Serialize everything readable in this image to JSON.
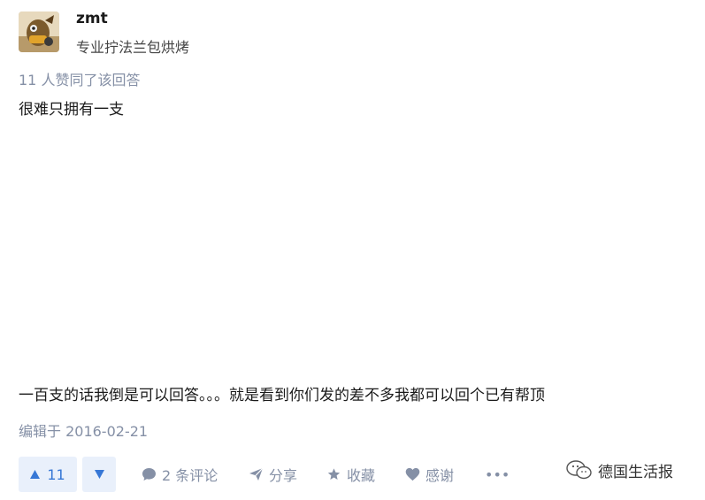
{
  "author": {
    "name": "zmt",
    "bio": "专业拧法兰包烘烤",
    "avatar_icon": "cartoon-avatar"
  },
  "answer": {
    "upvote_info": "11 人赞同了该回答",
    "lines": [
      "很难只拥有一支",
      "一百支的话我倒是可以回答。。。就是看到你们发的差不多我都可以回个已有帮顶"
    ],
    "edit_time": "编辑于 2016-02-21"
  },
  "actions": {
    "upvote_count": "11",
    "comments_label": "2 条评论",
    "share_label": "分享",
    "favorite_label": "收藏",
    "thanks_label": "感谢",
    "more_label": "•••"
  },
  "watermark": {
    "text": "德国生活报",
    "icon": "wechat-icon"
  },
  "colors": {
    "accent": "#3677d6",
    "accent_bg": "#e9f0fb",
    "muted": "#8590a6"
  }
}
